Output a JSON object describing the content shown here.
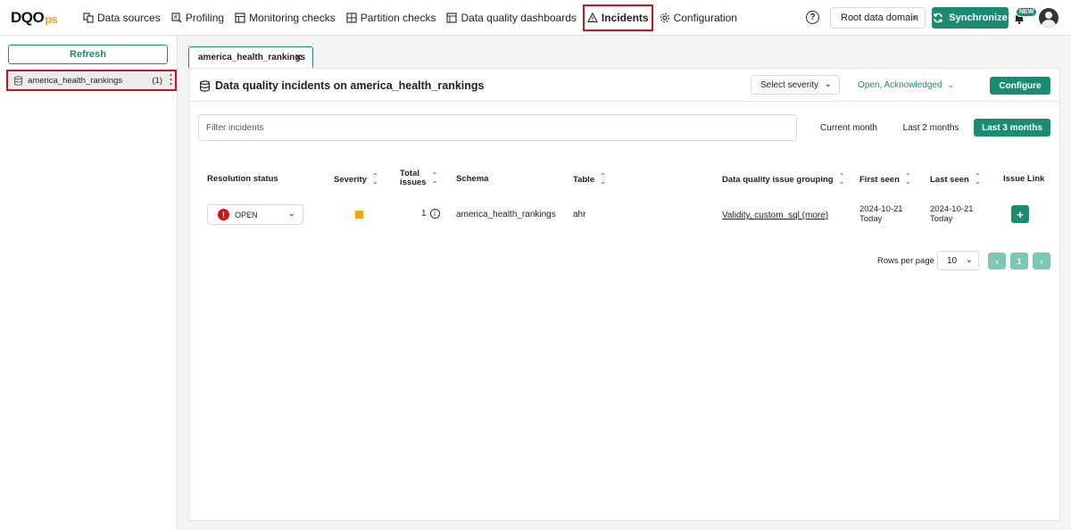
{
  "app": {
    "logo_main": "DQO",
    "logo_sub": "ps"
  },
  "nav": {
    "items": [
      {
        "label": "Data sources",
        "icon": "data-sources-icon"
      },
      {
        "label": "Profiling",
        "icon": "profiling-icon"
      },
      {
        "label": "Monitoring checks",
        "icon": "monitoring-icon"
      },
      {
        "label": "Partition checks",
        "icon": "partition-icon"
      },
      {
        "label": "Data quality dashboards",
        "icon": "dashboard-icon"
      },
      {
        "label": "Incidents",
        "icon": "warning-icon",
        "active": true
      },
      {
        "label": "Configuration",
        "icon": "gear-icon"
      }
    ],
    "help_glyph": "?",
    "domain_label": "Root data domain",
    "sync_label": "Synchronize",
    "new_badge": "NEW"
  },
  "sidebar": {
    "refresh_label": "Refresh",
    "items": [
      {
        "label": "america_health_rankings",
        "count": "(1)"
      }
    ]
  },
  "tab": {
    "label": "america_health_rankings"
  },
  "panel": {
    "title": "Data quality incidents on america_health_rankings",
    "severity_placeholder": "Select severity",
    "status_filter": "Open, Acknowledged",
    "configure_label": "Configure",
    "filter_placeholder": "Filter incidents",
    "ranges": [
      "Current month",
      "Last 2 months",
      "Last 3 months"
    ],
    "active_range": "Last 3 months"
  },
  "table": {
    "headers": {
      "resolution_status": "Resolution status",
      "severity": "Severity",
      "total_issues_1": "Total",
      "total_issues_2": "issues",
      "schema": "Schema",
      "table": "Table",
      "grouping": "Data quality issue grouping",
      "first_seen": "First seen",
      "last_seen": "Last seen",
      "issue_link": "Issue Link"
    },
    "rows": [
      {
        "status": "OPEN",
        "severity_color": "#f5a31a",
        "total_issues": "1",
        "schema": "america_health_rankings",
        "table": "ahr",
        "grouping": "Validity, custom_sql (more)",
        "first_seen_date": "2024-10-21",
        "first_seen_rel": "Today",
        "last_seen_date": "2024-10-21",
        "last_seen_rel": "Today",
        "issue_link_glyph": "+"
      }
    ]
  },
  "pagination": {
    "rows_label": "Rows per page",
    "rows_value": "10",
    "prev": "‹",
    "page": "1",
    "next": "›"
  },
  "colors": {
    "accent": "#1b8b72",
    "highlight": "#d0101b",
    "severity_warning": "#f5a31a"
  }
}
